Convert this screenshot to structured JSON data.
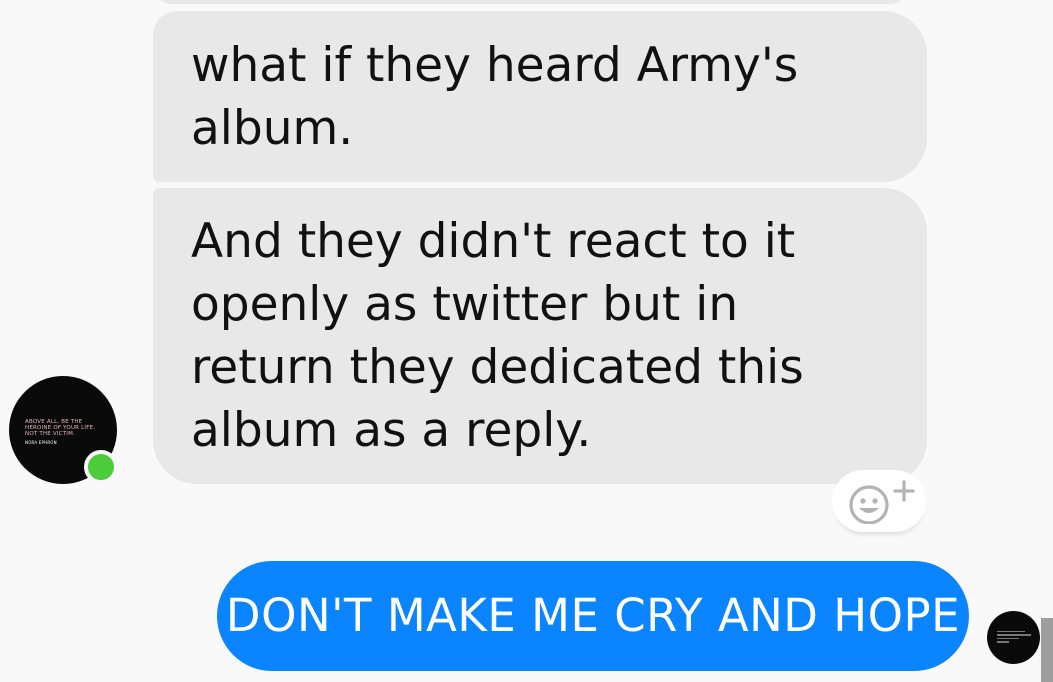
{
  "messages": [
    {
      "direction": "incoming",
      "text": "what if they heard Army's album."
    },
    {
      "direction": "incoming",
      "text": "And they didn't react to it openly as twitter but in return they dedicated this album as a reply."
    },
    {
      "direction": "outgoing",
      "text": "DON'T MAKE ME CRY AND HOPE"
    }
  ],
  "contact": {
    "avatar_quote": "ABOVE ALL, BE THE HEROINE OF YOUR LIFE, NOT THE VICTIM.",
    "avatar_author": "NORA EPHRON",
    "online": true,
    "online_color": "#4ccb3b"
  },
  "reaction": {
    "icon": "add-reaction-icon"
  },
  "colors": {
    "incoming_bubble": "#e8e8e8",
    "outgoing_bubble": "#0a84ff",
    "background": "#f9f9f9"
  }
}
